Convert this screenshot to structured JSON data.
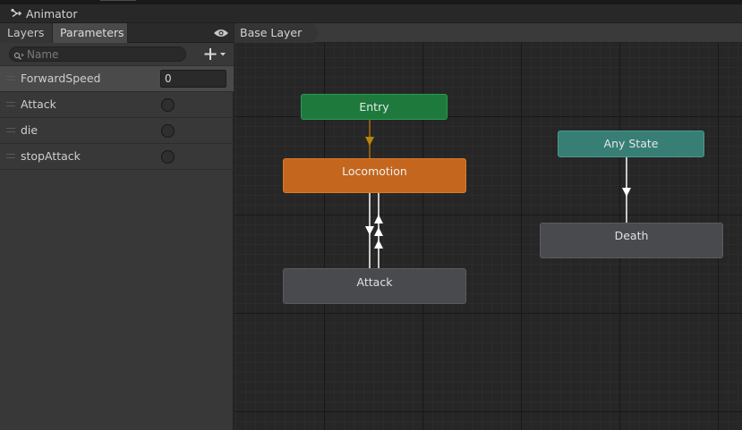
{
  "window": {
    "title": "Animator",
    "title_icon": "animator-icon"
  },
  "left_panel": {
    "tabs": [
      {
        "label": "Layers"
      },
      {
        "label": "Parameters"
      }
    ],
    "active_tab": "Parameters",
    "eye_icon": "eye-icon",
    "search": {
      "placeholder": "Name",
      "value": ""
    },
    "add_icon": "plus-dropdown-icon",
    "parameters": [
      {
        "name": "ForwardSpeed",
        "type": "float",
        "value": "0"
      },
      {
        "name": "Attack",
        "type": "trigger",
        "value": ""
      },
      {
        "name": "die",
        "type": "trigger",
        "value": ""
      },
      {
        "name": "stopAttack",
        "type": "trigger",
        "value": ""
      }
    ]
  },
  "graph": {
    "breadcrumb": "Base Layer",
    "states": {
      "entry": {
        "label": "Entry",
        "color": "#1d7a3c"
      },
      "locomotion": {
        "label": "Locomotion",
        "color": "#c4661d"
      },
      "attack": {
        "label": "Attack",
        "color": "#494a4d"
      },
      "any_state": {
        "label": "Any State",
        "color": "#377e74"
      },
      "death": {
        "label": "Death",
        "color": "#494a4d"
      }
    },
    "transitions": [
      {
        "from": "Entry",
        "to": "Locomotion",
        "default": true
      },
      {
        "from": "Locomotion",
        "to": "Attack"
      },
      {
        "from": "Attack",
        "to": "Locomotion",
        "count": 2
      },
      {
        "from": "Any State",
        "to": "Death"
      }
    ]
  }
}
